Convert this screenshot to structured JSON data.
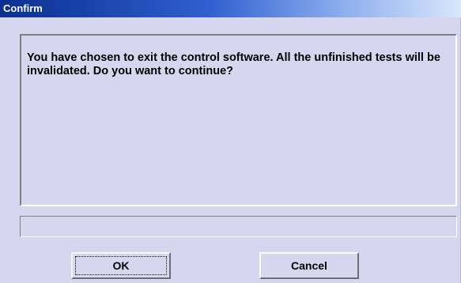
{
  "window": {
    "title": "Confirm"
  },
  "message": {
    "text": "You have chosen to exit the control software. All the unfinished tests will be invalidated. Do you want to continue?"
  },
  "status": {
    "value": ""
  },
  "buttons": {
    "ok_label": "OK",
    "cancel_label": "Cancel"
  },
  "colors": {
    "dialog_background": "#d6d7ef",
    "titlebar_start": "#0a2f8f",
    "titlebar_end": "#d9e6fb",
    "title_text": "#ffffff"
  }
}
